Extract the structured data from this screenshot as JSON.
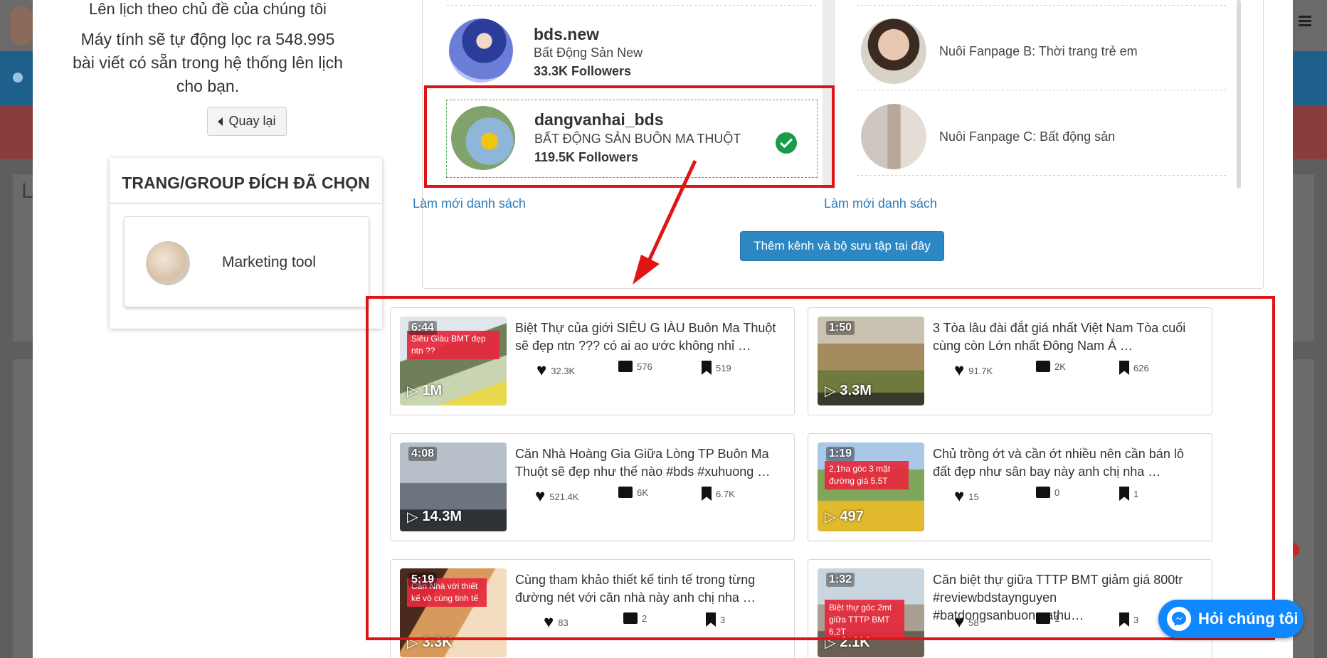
{
  "left": {
    "heading_partial": "Lên lịch theo chủ đề của chúng tôi",
    "description": [
      "Máy tính sẽ tự động lọc ra 548.995",
      "bài viết có sẵn trong hệ thống lên lịch",
      "cho bạn."
    ],
    "back_label": "Quay lại",
    "targets_title": "TRANG/GROUP ĐÍCH ĐÃ CHỌN",
    "target_label": "Marketing tool"
  },
  "accounts": [
    {
      "name": "bds.new",
      "desc": "Bất Động Sản New",
      "followers": "33.3K Followers"
    },
    {
      "name": "dangvanhai_bds",
      "desc": "BẤT ĐỘNG SẢN BUÔN MA THUỘT",
      "followers": "119.5K Followers",
      "selected": true
    }
  ],
  "fanpages": [
    "Nuôi Fanpage B: Thời trang trẻ em",
    "Nuôi Fanpage C: Bất động sản"
  ],
  "refresh_label": "Làm mới danh sách",
  "add_channel_label": "Thêm kênh và bộ sưu tập tại đây",
  "backdrop_letter": "L",
  "chat_label": "Hỏi chúng tôi",
  "colors": {
    "annotation": "#e01414",
    "accent": "#2c87c3",
    "check": "#1a9b4b",
    "messenger": "#0f87ff"
  },
  "videos": [
    {
      "duration": "6:44",
      "views": "1M",
      "overlay": "Siêu Giàu BMT đẹp ntn ??",
      "title": "Biệt Thự của giới SIÊU G IÀU Buôn Ma Thuột sẽ đẹp ntn ??? có ai ao ước không nhỉ …",
      "likes": "32.3K",
      "comments": "576",
      "saves": "519"
    },
    {
      "duration": "1:50",
      "views": "3.3M",
      "overlay": "",
      "title": "3 Tòa lâu đài đắt giá nhất Việt Nam  Tòa cuối cùng còn Lớn nhất Đông Nam Á …",
      "likes": "91.7K",
      "comments": "2K",
      "saves": "626"
    },
    {
      "duration": "4:08",
      "views": "14.3M",
      "overlay": "",
      "title": "Căn Nhà Hoàng Gia Giữa Lòng TP Buôn Ma Thuột sẽ đẹp như thế nào  #bds #xuhuong …",
      "likes": "521.4K",
      "comments": "6K",
      "saves": "6.7K"
    },
    {
      "duration": "1:19",
      "views": "497",
      "overlay": "2,1ha góc 3 mặt đường giá 5,5T",
      "title": "Chủ trồng ớt và cần ớt nhiều nên cần bán lô đất đẹp như sân bay này anh chị nha  …",
      "likes": "15",
      "comments": "0",
      "saves": "1"
    },
    {
      "duration": "5:19",
      "views": "3.3K",
      "overlay": "Căn Nhà với thiết kế vô cùng tinh tế",
      "title": "Cùng tham khảo thiết kế tinh tế trong từng đường nét với căn nhà này anh chị nha …",
      "likes": "83",
      "comments": "2",
      "saves": "3"
    },
    {
      "duration": "1:32",
      "views": "2.1K",
      "overlay": "Biệt thự góc 2mt giữa TTTP BMT 6,2T",
      "title": "Căn biệt thự giữa TTTP BMT giảm giá 800tr #reviewbdstaynguyen #batdongsanbuonmathu…",
      "likes": "58",
      "comments": "1",
      "saves": "3"
    }
  ]
}
